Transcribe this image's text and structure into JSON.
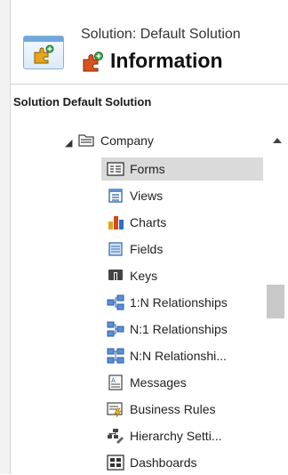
{
  "header": {
    "subtitle": "Solution: Default Solution",
    "title": "Information"
  },
  "solution_label": "Solution Default Solution",
  "tree": {
    "parent": {
      "label": "Company",
      "icon": "entity-icon",
      "expanded": true
    },
    "items": [
      {
        "label": "Forms",
        "icon": "forms-icon",
        "selected": true
      },
      {
        "label": "Views",
        "icon": "views-icon"
      },
      {
        "label": "Charts",
        "icon": "charts-icon"
      },
      {
        "label": "Fields",
        "icon": "fields-icon"
      },
      {
        "label": "Keys",
        "icon": "keys-icon"
      },
      {
        "label": "1:N Relationships",
        "icon": "one-to-many-icon"
      },
      {
        "label": "N:1 Relationships",
        "icon": "many-to-one-icon"
      },
      {
        "label": "N:N Relationshi...",
        "icon": "many-to-many-icon"
      },
      {
        "label": "Messages",
        "icon": "messages-icon"
      },
      {
        "label": "Business Rules",
        "icon": "business-rules-icon"
      },
      {
        "label": "Hierarchy Setti...",
        "icon": "hierarchy-icon"
      },
      {
        "label": "Dashboards",
        "icon": "dashboards-icon"
      }
    ]
  },
  "colors": {
    "selected_bg": "#dadada",
    "accent": "#1e73c8"
  }
}
